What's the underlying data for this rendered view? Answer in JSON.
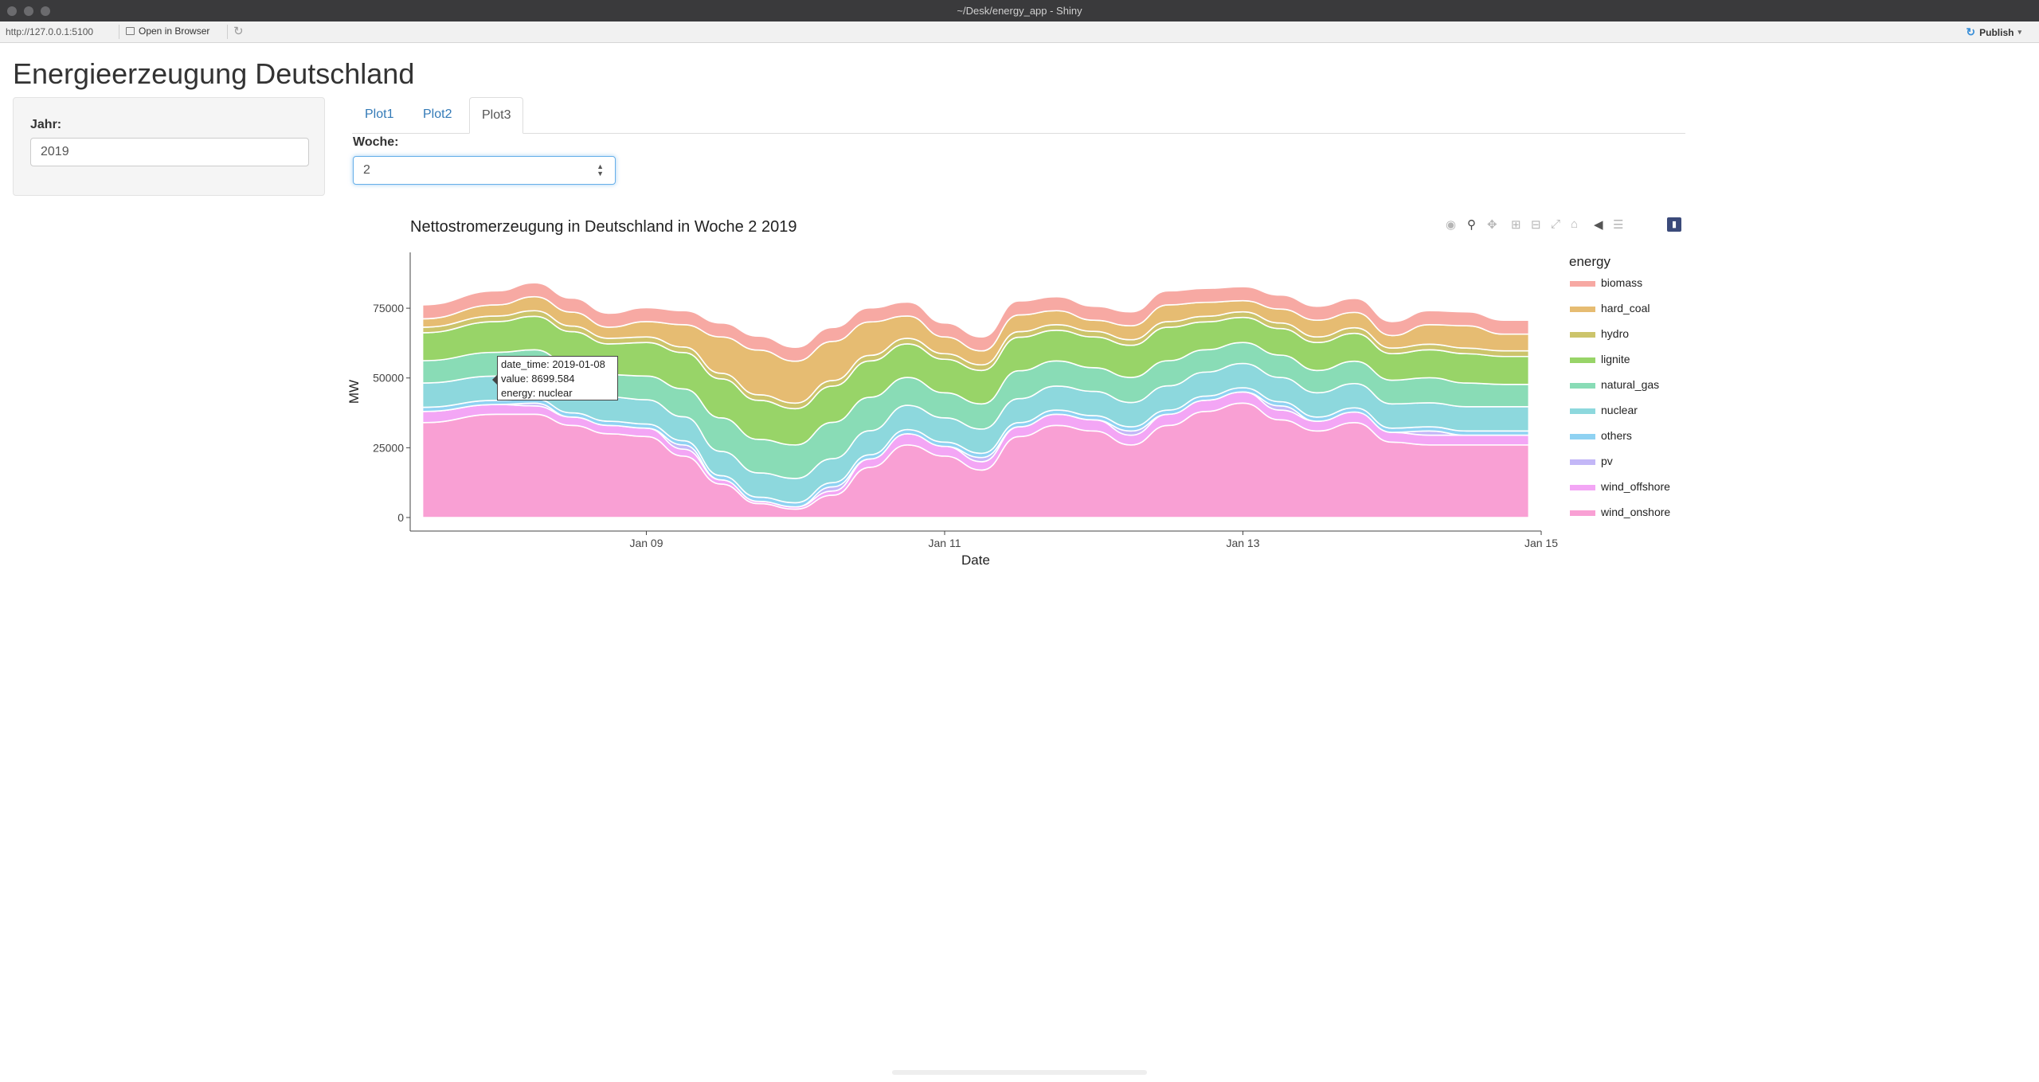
{
  "window": {
    "title": "~/Desk/energy_app - Shiny"
  },
  "toolbar": {
    "url": "http://127.0.0.1:5100",
    "open_in_browser": "Open in Browser",
    "refresh_icon": "refresh-icon",
    "publish": "Publish"
  },
  "page": {
    "title": "Energieerzeugung Deutschland"
  },
  "sidebar": {
    "year_label": "Jahr:",
    "year_value": "2019"
  },
  "tabs": [
    {
      "label": "Plot1",
      "active": false
    },
    {
      "label": "Plot2",
      "active": false
    },
    {
      "label": "Plot3",
      "active": true
    }
  ],
  "week": {
    "label": "Woche:",
    "value": "2"
  },
  "tooltip": {
    "line1": "date_time: 2019-01-08",
    "line2": "value:  8699.584",
    "line3": "energy: nuclear"
  },
  "chart_data": {
    "type": "area",
    "stacked": true,
    "title": "Nettostromerzeugung in Deutschland in Woche 2 2019",
    "xlabel": "Date",
    "ylabel": "MW",
    "x_ticks": [
      "Jan 09",
      "Jan 11",
      "Jan 13",
      "Jan 15"
    ],
    "y_ticks": [
      0,
      25000,
      50000,
      75000
    ],
    "ylim": [
      0,
      95000
    ],
    "xlim": [
      "2019-01-07T10:00",
      "2019-01-15T00:00"
    ],
    "legend_title": "energy",
    "legend_position": "right",
    "x": [
      "2019-01-07T12:00",
      "2019-01-08T00:00",
      "2019-01-08T06:00",
      "2019-01-08T12:00",
      "2019-01-08T18:00",
      "2019-01-09T00:00",
      "2019-01-09T06:00",
      "2019-01-09T12:00",
      "2019-01-09T18:00",
      "2019-01-10T00:00",
      "2019-01-10T06:00",
      "2019-01-10T12:00",
      "2019-01-10T18:00",
      "2019-01-11T00:00",
      "2019-01-11T06:00",
      "2019-01-11T12:00",
      "2019-01-11T18:00",
      "2019-01-12T00:00",
      "2019-01-12T06:00",
      "2019-01-12T12:00",
      "2019-01-12T18:00",
      "2019-01-13T00:00",
      "2019-01-13T06:00",
      "2019-01-13T12:00",
      "2019-01-13T18:00",
      "2019-01-14T00:00",
      "2019-01-14T06:00",
      "2019-01-14T12:00",
      "2019-01-14T18:00",
      "2019-01-14T22:00"
    ],
    "series": [
      {
        "name": "wind_onshore",
        "color": "#f9a0d4",
        "values": [
          34000,
          37000,
          37000,
          33000,
          30000,
          29000,
          22000,
          12000,
          5000,
          3000,
          8000,
          18000,
          26000,
          22000,
          17000,
          29000,
          33000,
          31000,
          26000,
          33000,
          38000,
          41000,
          35000,
          31000,
          34000,
          27000,
          26000,
          26000,
          26000,
          26000
        ]
      },
      {
        "name": "wind_offshore",
        "color": "#f3a6f5",
        "values": [
          4000,
          3500,
          3000,
          3000,
          3000,
          3000,
          2500,
          1500,
          800,
          800,
          1500,
          3000,
          4000,
          3500,
          3000,
          3500,
          4000,
          4000,
          3500,
          4000,
          4000,
          4000,
          3500,
          3500,
          3800,
          3500,
          3500,
          3500,
          3500,
          3500
        ]
      },
      {
        "name": "pv",
        "color": "#c3b7f7",
        "values": [
          0,
          0,
          1000,
          0,
          0,
          0,
          1500,
          0,
          0,
          0,
          1500,
          0,
          0,
          0,
          1500,
          0,
          0,
          0,
          1500,
          0,
          0,
          0,
          1500,
          0,
          0,
          0,
          1500,
          0,
          0,
          0
        ]
      },
      {
        "name": "others",
        "color": "#8fd2f2",
        "values": [
          1500,
          1500,
          1500,
          1500,
          1500,
          1500,
          1500,
          1500,
          1500,
          1500,
          1500,
          1500,
          1500,
          1500,
          1500,
          1500,
          1500,
          1500,
          1500,
          1500,
          1500,
          1500,
          1500,
          1500,
          1500,
          1500,
          1500,
          1500,
          1500,
          1500
        ]
      },
      {
        "name": "nuclear",
        "color": "#8dd8dd",
        "values": [
          8700,
          8700,
          8600,
          8600,
          8700,
          8700,
          8600,
          8700,
          8700,
          8700,
          8600,
          8600,
          8700,
          8700,
          8700,
          8600,
          8600,
          8700,
          8700,
          8700,
          8600,
          8700,
          8700,
          8700,
          8700,
          8700,
          8600,
          8700,
          8700,
          8700
        ]
      },
      {
        "name": "natural_gas",
        "color": "#89dcb6",
        "values": [
          8000,
          8500,
          9000,
          8500,
          8000,
          8500,
          10000,
          12000,
          12000,
          12000,
          13000,
          12000,
          10000,
          9000,
          9000,
          10000,
          9000,
          8500,
          9000,
          9000,
          8000,
          7500,
          8000,
          8000,
          8000,
          8500,
          9000,
          8500,
          8000,
          8000
        ]
      },
      {
        "name": "lignite",
        "color": "#98d468",
        "values": [
          10000,
          11000,
          12000,
          12000,
          11000,
          12000,
          13000,
          14000,
          14000,
          13000,
          13000,
          13000,
          12000,
          12000,
          12000,
          12000,
          11000,
          11000,
          11500,
          12000,
          10000,
          9000,
          9500,
          10000,
          10000,
          9500,
          10000,
          10500,
          10000,
          10000
        ]
      },
      {
        "name": "hydro",
        "color": "#ccc46b",
        "values": [
          2000,
          2000,
          2000,
          2000,
          2000,
          2000,
          2000,
          2000,
          2000,
          2000,
          2000,
          2000,
          2000,
          2000,
          2000,
          2000,
          2000,
          2000,
          2000,
          2000,
          2000,
          2000,
          2000,
          2000,
          2000,
          2000,
          2000,
          2000,
          2000,
          2000
        ]
      },
      {
        "name": "hard_coal",
        "color": "#e6bc72",
        "values": [
          3000,
          4000,
          5000,
          5000,
          4000,
          5500,
          8000,
          13000,
          16000,
          15000,
          14000,
          12000,
          8000,
          6000,
          5000,
          6000,
          5000,
          4000,
          5000,
          6000,
          5000,
          4000,
          5000,
          6000,
          5500,
          4500,
          7000,
          8000,
          6000,
          6000
        ]
      },
      {
        "name": "biomass",
        "color": "#f7a9a3",
        "values": [
          5000,
          5000,
          5000,
          5000,
          5000,
          5000,
          5000,
          5000,
          5000,
          5000,
          5000,
          5000,
          5000,
          5000,
          5000,
          5000,
          5000,
          5000,
          5000,
          5000,
          5000,
          5000,
          5000,
          5000,
          5000,
          5000,
          5000,
          5000,
          5000,
          5000
        ]
      }
    ],
    "legend_order": [
      "biomass",
      "hard_coal",
      "hydro",
      "lignite",
      "natural_gas",
      "nuclear",
      "others",
      "pv",
      "wind_offshore",
      "wind_onshore"
    ]
  }
}
